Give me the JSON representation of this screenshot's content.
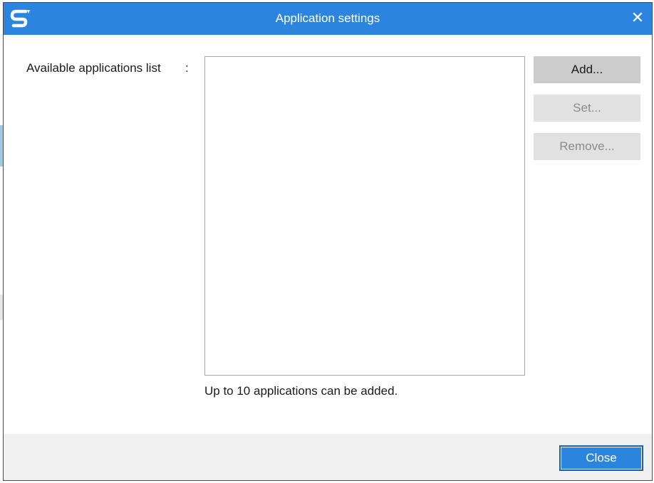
{
  "dialog": {
    "title": "Application settings",
    "close_glyph": "✕",
    "app_icon": "scansnap-logo-icon"
  },
  "content": {
    "list_label": "Available applications list",
    "list_colon": ":",
    "hint": "Up to 10 applications can be added.",
    "applications": []
  },
  "buttons": {
    "add": "Add...",
    "set": "Set...",
    "remove": "Remove...",
    "close": "Close"
  },
  "colors": {
    "titlebar": "#2b85de",
    "disabled_text": "#8c8c8c",
    "footer": "#f0f0f0"
  }
}
